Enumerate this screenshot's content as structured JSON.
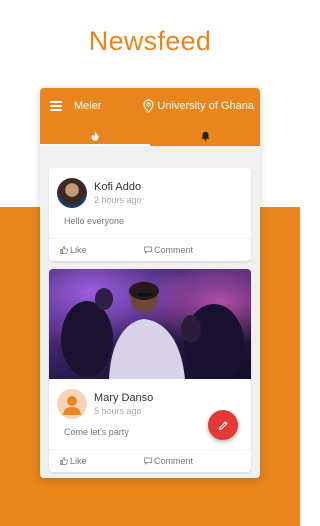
{
  "headline": "Newsfeed",
  "appbar": {
    "title": "Meler",
    "location": "University of Ghana",
    "menu_icon": "hamburger-icon",
    "location_icon": "map-pin-icon"
  },
  "tabs": [
    {
      "icon": "flame-icon",
      "active": true
    },
    {
      "icon": "bell-icon",
      "active": false
    }
  ],
  "posts": [
    {
      "author": "Kofi Addo",
      "time": "2 hours ago",
      "text": "Hello everyone",
      "like_label": "Like",
      "comment_label": "Comment",
      "has_image": false,
      "avatar": "photo"
    },
    {
      "author": "Mary Danso",
      "time": "5 hours ago",
      "text": "Come let's party",
      "like_label": "Like",
      "comment_label": "Comment",
      "has_image": true,
      "avatar": "placeholder"
    }
  ],
  "fab_icon": "pencil-icon",
  "colors": {
    "accent": "#e8851c",
    "fab": "#e53935"
  }
}
